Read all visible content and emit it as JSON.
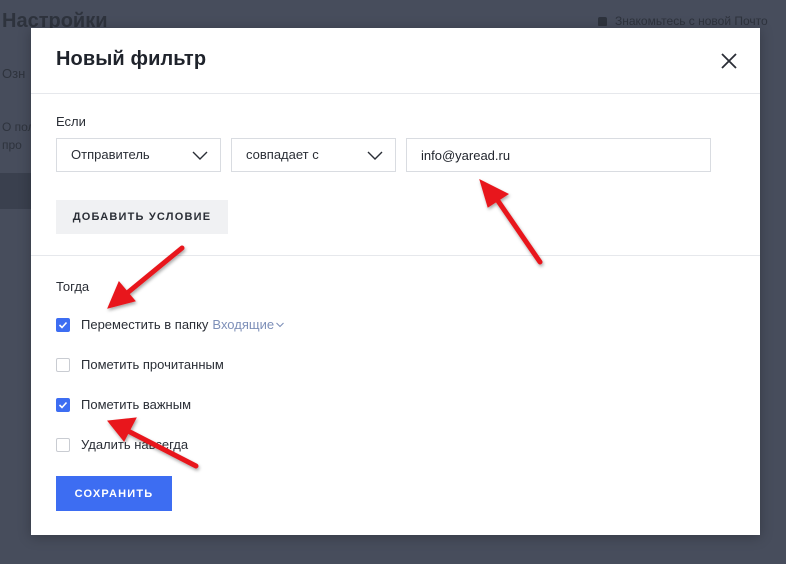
{
  "background_page": {
    "title": "Настройки",
    "notice": "Знакомьтесь с новой Почто",
    "fragment_1": "Озн",
    "fragment_2": "О пол",
    "fragment_3": "про"
  },
  "modal": {
    "title": "Новый фильтр",
    "close_icon": "close-icon"
  },
  "condition": {
    "section_label": "Если",
    "field_select": "Отправитель",
    "operator_select": "совпадает с",
    "value_input": "info@yaread.ru",
    "add_condition_label": "ДОБАВИТЬ УСЛОВИЕ"
  },
  "actions": {
    "section_label": "Тогда",
    "options": [
      {
        "label": "Переместить в папку",
        "checked": true,
        "folder": "Входящие"
      },
      {
        "label": "Пометить прочитанным",
        "checked": false
      },
      {
        "label": "Пометить важным",
        "checked": true
      },
      {
        "label": "Удалить навсегда",
        "checked": false
      }
    ],
    "save_label": "СОХРАНИТЬ"
  },
  "colors": {
    "accent": "#3d6df2",
    "overlay": "#474d5c",
    "annotation_arrow": "#e8151b",
    "folder_link": "#7d8fb8"
  }
}
